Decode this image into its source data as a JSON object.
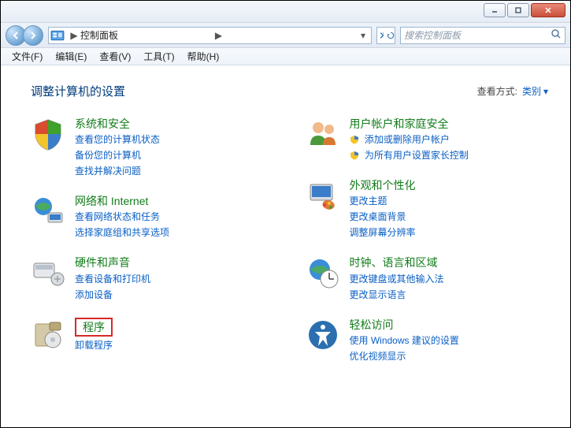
{
  "titlebar": {
    "minimize": "minimize",
    "maximize": "maximize",
    "close": "close"
  },
  "addressbar": {
    "location": "控制面板",
    "chevron": "▶",
    "dropdown": "▾"
  },
  "search": {
    "placeholder": "搜索控制面板"
  },
  "menubar": {
    "items": [
      "文件(F)",
      "编辑(E)",
      "查看(V)",
      "工具(T)",
      "帮助(H)"
    ]
  },
  "heading": "调整计算机的设置",
  "viewby": {
    "label": "查看方式:",
    "value": "类别"
  },
  "left": [
    {
      "icon": "shield-icon",
      "title": "系统和安全",
      "links": [
        "查看您的计算机状态",
        "备份您的计算机",
        "查找并解决问题"
      ]
    },
    {
      "icon": "network-icon",
      "title": "网络和 Internet",
      "links": [
        "查看网络状态和任务",
        "选择家庭组和共享选项"
      ]
    },
    {
      "icon": "hardware-icon",
      "title": "硬件和声音",
      "links": [
        "查看设备和打印机",
        "添加设备"
      ]
    },
    {
      "icon": "programs-icon",
      "title": "程序",
      "links": [
        "卸载程序"
      ],
      "highlighted": true
    }
  ],
  "right": [
    {
      "icon": "users-icon",
      "title": "用户帐户和家庭安全",
      "links": [
        {
          "text": "添加或删除用户帐户",
          "shield": true
        },
        {
          "text": "为所有用户设置家长控制",
          "shield": true
        }
      ]
    },
    {
      "icon": "appearance-icon",
      "title": "外观和个性化",
      "links": [
        "更改主题",
        "更改桌面背景",
        "调整屏幕分辨率"
      ]
    },
    {
      "icon": "clock-icon",
      "title": "时钟、语言和区域",
      "links": [
        "更改键盘或其他输入法",
        "更改显示语言"
      ]
    },
    {
      "icon": "ease-icon",
      "title": "轻松访问",
      "links": [
        "使用 Windows 建议的设置",
        "优化视频显示"
      ]
    }
  ]
}
